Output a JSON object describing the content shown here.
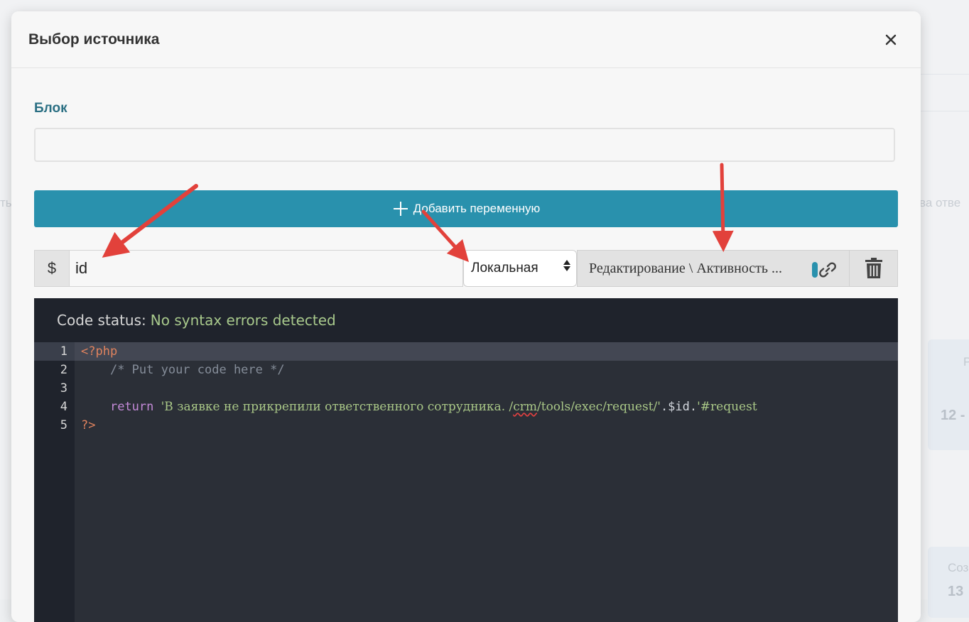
{
  "background": {
    "left_text": "ть",
    "right_text": "ва отве",
    "card1_label": "Р",
    "card1_value": "12 -",
    "card2_label": "Соз",
    "card2_value": "13"
  },
  "modal": {
    "title": "Выбор источника",
    "close_label": "×"
  },
  "block": {
    "label": "Блок",
    "value": ""
  },
  "add_variable": {
    "label": "Добавить переменную"
  },
  "variable_row": {
    "prefix": "$",
    "name": "id",
    "scope": "Локальная",
    "source": "Редактирование \\ Активность ..."
  },
  "editor": {
    "status_label": "Code status:",
    "status_value": "No syntax errors detected",
    "lines": [
      {
        "num": "1",
        "open_tag": "<?php"
      },
      {
        "num": "2",
        "comment": "/* Put your code here */"
      },
      {
        "num": "3"
      },
      {
        "num": "4",
        "keyword": "return",
        "str1a": "'В заявке не прикрепили ответственного сотрудника. /",
        "str1b": "crm",
        "str1c": "/tools/exec/request/'",
        "concat1": ".$id.",
        "str2": "'#request"
      },
      {
        "num": "5",
        "close_tag": "?>"
      }
    ]
  },
  "colors": {
    "accent": "#2991ad",
    "label_teal": "#2a6f83",
    "arrow_red": "#e2413b",
    "editor_bg": "#2b2f37"
  }
}
